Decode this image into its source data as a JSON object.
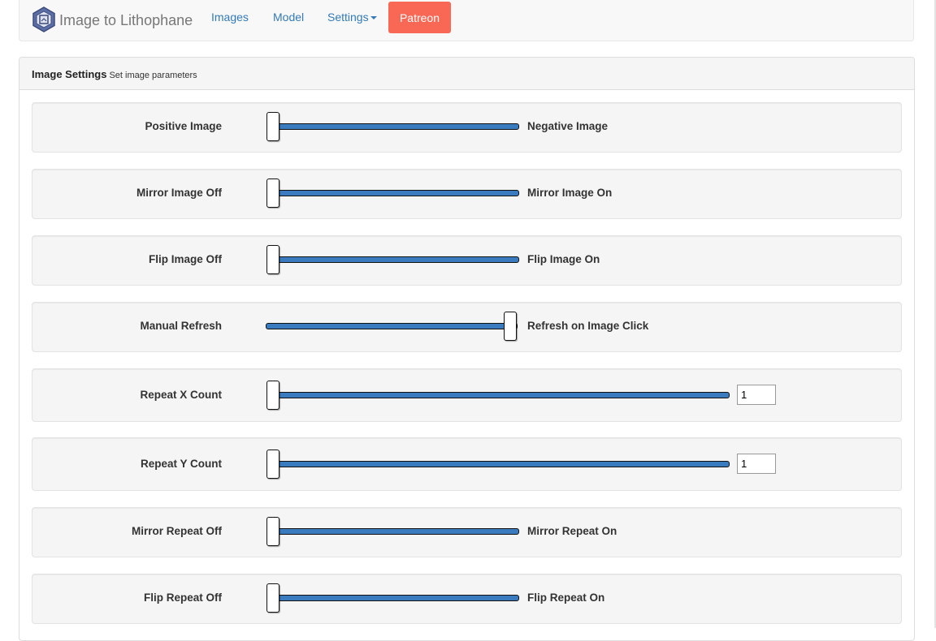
{
  "navbar": {
    "brand": "Image to Lithophane",
    "links": [
      "Images",
      "Model",
      "Settings"
    ],
    "patreon": "Patreon",
    "colors": {
      "link": "#337ab7",
      "patreon": "#f96854"
    }
  },
  "panel": {
    "title": "Image Settings",
    "subtitle": "Set image parameters"
  },
  "rows": [
    {
      "left": "Positive Image",
      "right": "Negative Image",
      "value": 0
    },
    {
      "left": "Mirror Image Off",
      "right": "Mirror Image On",
      "value": 0
    },
    {
      "left": "Flip Image Off",
      "right": "Flip Image On",
      "value": 0
    },
    {
      "left": "Manual Refresh",
      "right": "Refresh on Image Click",
      "value": 1
    },
    {
      "left": "Repeat X Count",
      "input": "1",
      "value": 0
    },
    {
      "left": "Repeat Y Count",
      "input": "1",
      "value": 0
    },
    {
      "left": "Mirror Repeat Off",
      "right": "Mirror Repeat On",
      "value": 0
    },
    {
      "left": "Flip Repeat Off",
      "right": "Flip Repeat On",
      "value": 0
    }
  ],
  "icons": {
    "logo": "lithophane-logo-icon",
    "annotation": "red-arrow-icon",
    "caret": "caret-down-icon"
  },
  "colors": {
    "slider_track": "#3a7bbf",
    "annotation_arrow": "#e00000"
  }
}
